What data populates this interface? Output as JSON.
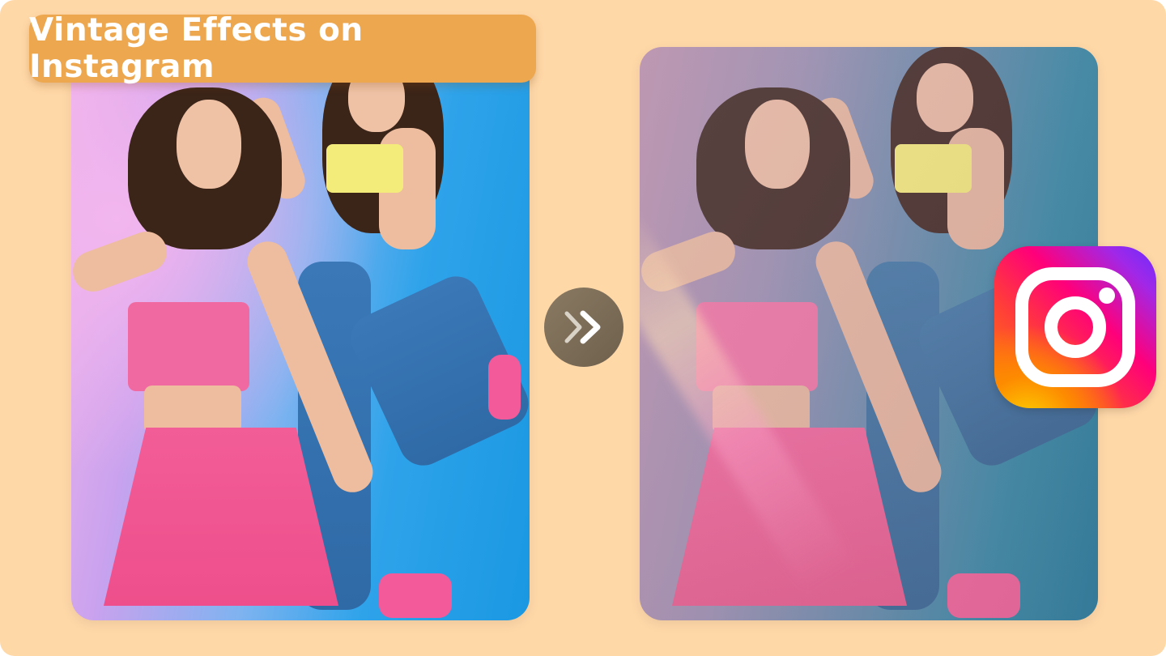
{
  "header": {
    "title": "Vintage Effects on Instagram"
  },
  "images": {
    "before": "original-photo",
    "after": "vintage-filtered-photo"
  },
  "icons": {
    "arrow": "double-chevron-right-icon",
    "brand": "instagram-icon"
  },
  "colors": {
    "background": "#ffd8a8",
    "badge": "#eda74f",
    "arrow_button": "#7a6c57"
  }
}
